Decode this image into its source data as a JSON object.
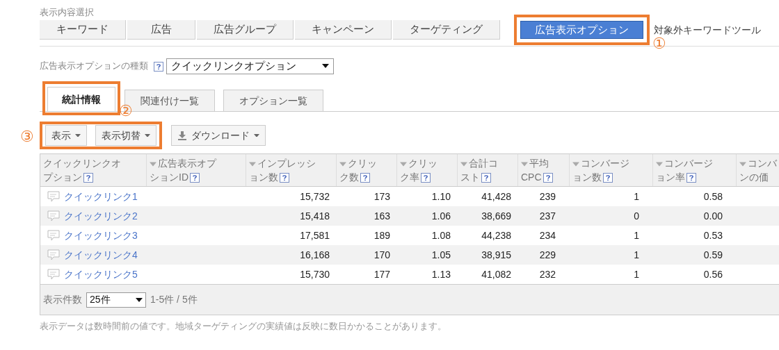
{
  "view_selector": {
    "label": "表示内容選択",
    "tabs": [
      {
        "label": "キーワード",
        "selected": false
      },
      {
        "label": "広告",
        "selected": false
      },
      {
        "label": "広告グループ",
        "selected": false
      },
      {
        "label": "キャンペーン",
        "selected": false
      },
      {
        "label": "ターゲティング",
        "selected": false
      },
      {
        "label": "広告表示オプション",
        "selected": true,
        "callout": "①"
      }
    ],
    "link": "対象外キーワードツール"
  },
  "option_type": {
    "label": "広告表示オプションの種類",
    "value": "クイックリンクオプション"
  },
  "tabs": [
    {
      "label": "統計情報",
      "selected": true,
      "callout": "②"
    },
    {
      "label": "関連付け一覧",
      "selected": false
    },
    {
      "label": "オプション一覧",
      "selected": false
    }
  ],
  "toolbar_callout": "③",
  "toolbar": [
    {
      "label": "表示",
      "kind": "menu",
      "framed": true
    },
    {
      "label": "表示切替",
      "kind": "menu",
      "framed": true
    },
    {
      "label": "ダウンロード",
      "kind": "download"
    }
  ],
  "table": {
    "columns": [
      {
        "lines": [
          "クイックリンクオ",
          "プション"
        ],
        "sortable": false,
        "help": true
      },
      {
        "lines": [
          "広告表示オプ",
          "ションID"
        ],
        "sortable": true,
        "help": true
      },
      {
        "lines": [
          "インプレッシ",
          "ョン数"
        ],
        "sortable": true,
        "help": true
      },
      {
        "lines": [
          "クリッ",
          "ク数"
        ],
        "sortable": true,
        "help": true
      },
      {
        "lines": [
          "クリッ",
          "ク率"
        ],
        "sortable": true,
        "help": true
      },
      {
        "lines": [
          "合計コ",
          "スト"
        ],
        "sortable": true,
        "help": true
      },
      {
        "lines": [
          "平均",
          "CPC"
        ],
        "sortable": true,
        "help": true
      },
      {
        "lines": [
          "コンバージ",
          "ョン数"
        ],
        "sortable": true,
        "help": true
      },
      {
        "lines": [
          "コンバージ",
          "ョン率"
        ],
        "sortable": true,
        "help": true
      },
      {
        "lines": [
          "コンバ",
          "ンの価"
        ],
        "sortable": true,
        "help": false
      }
    ],
    "rows": [
      {
        "name": "クイックリンク1",
        "values": [
          "15,732",
          "173",
          "1.10",
          "41,428",
          "239",
          "1",
          "0.58"
        ]
      },
      {
        "name": "クイックリンク2",
        "values": [
          "15,418",
          "163",
          "1.06",
          "38,669",
          "237",
          "0",
          "0.00"
        ]
      },
      {
        "name": "クイックリンク3",
        "values": [
          "17,581",
          "189",
          "1.08",
          "44,238",
          "234",
          "1",
          "0.53"
        ]
      },
      {
        "name": "クイックリンク4",
        "values": [
          "16,168",
          "170",
          "1.05",
          "38,915",
          "229",
          "1",
          "0.59"
        ]
      },
      {
        "name": "クイックリンク5",
        "values": [
          "15,730",
          "177",
          "1.13",
          "41,082",
          "232",
          "1",
          "0.56"
        ]
      }
    ]
  },
  "footer": {
    "label": "表示件数",
    "page_size": "25件",
    "range": "1-5件 / 5件"
  },
  "note": "表示データは数時間前の値です。地域ターゲティングの実績値は反映に数日かかることがあります。"
}
